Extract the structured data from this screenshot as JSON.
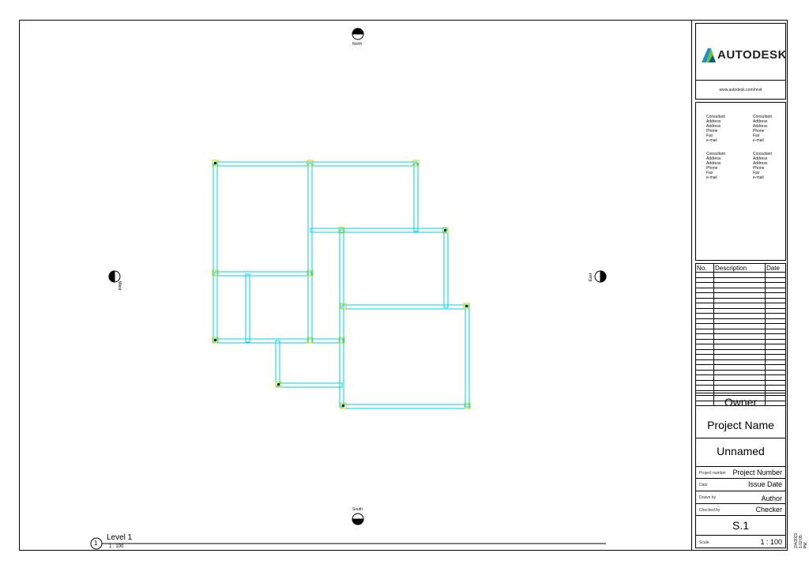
{
  "title_block": {
    "logo_text": "AUTODESK",
    "url": "www.autodesk.com/revit",
    "consultants": [
      {
        "lines": [
          "Consultant",
          "Address",
          "Address",
          "Phone",
          "Fax",
          "e-mail"
        ]
      },
      {
        "lines": [
          "Consultant",
          "Address",
          "Address",
          "Phone",
          "Fax",
          "e-mail"
        ]
      },
      {
        "lines": [
          "Consultant",
          "Address",
          "Address",
          "Phone",
          "Fax",
          "e-mail"
        ]
      },
      {
        "lines": [
          "Consultant",
          "Address",
          "Address",
          "Phone",
          "Fax",
          "e-mail"
        ]
      }
    ],
    "revision_headers": {
      "no": "No.",
      "description": "Description",
      "date": "Date"
    },
    "owner": "Owner",
    "project_name": "Project Name",
    "sheet_name": "Unnamed",
    "project_number_label": "Project number",
    "project_number": "Project Number",
    "date_label": "Date",
    "date_value": "Issue Date",
    "drawn_by_label": "Drawn by",
    "drawn_by": "Author",
    "checked_by_label": "Checked by",
    "checked_by": "Checker",
    "sheet_number": "S.1",
    "scale_label": "Scale",
    "scale_value": "1 : 100",
    "timestamp": "2/4/2021 1:02:05 PM"
  },
  "view": {
    "view_number": "1",
    "view_title": "Level 1",
    "view_scale": "1 : 100"
  },
  "elevation_markers": {
    "north": "North",
    "south": "South",
    "east": "East",
    "west": "West"
  },
  "colors": {
    "beam": "#00d0e0",
    "column": "#c8d400",
    "line": "#000000"
  }
}
